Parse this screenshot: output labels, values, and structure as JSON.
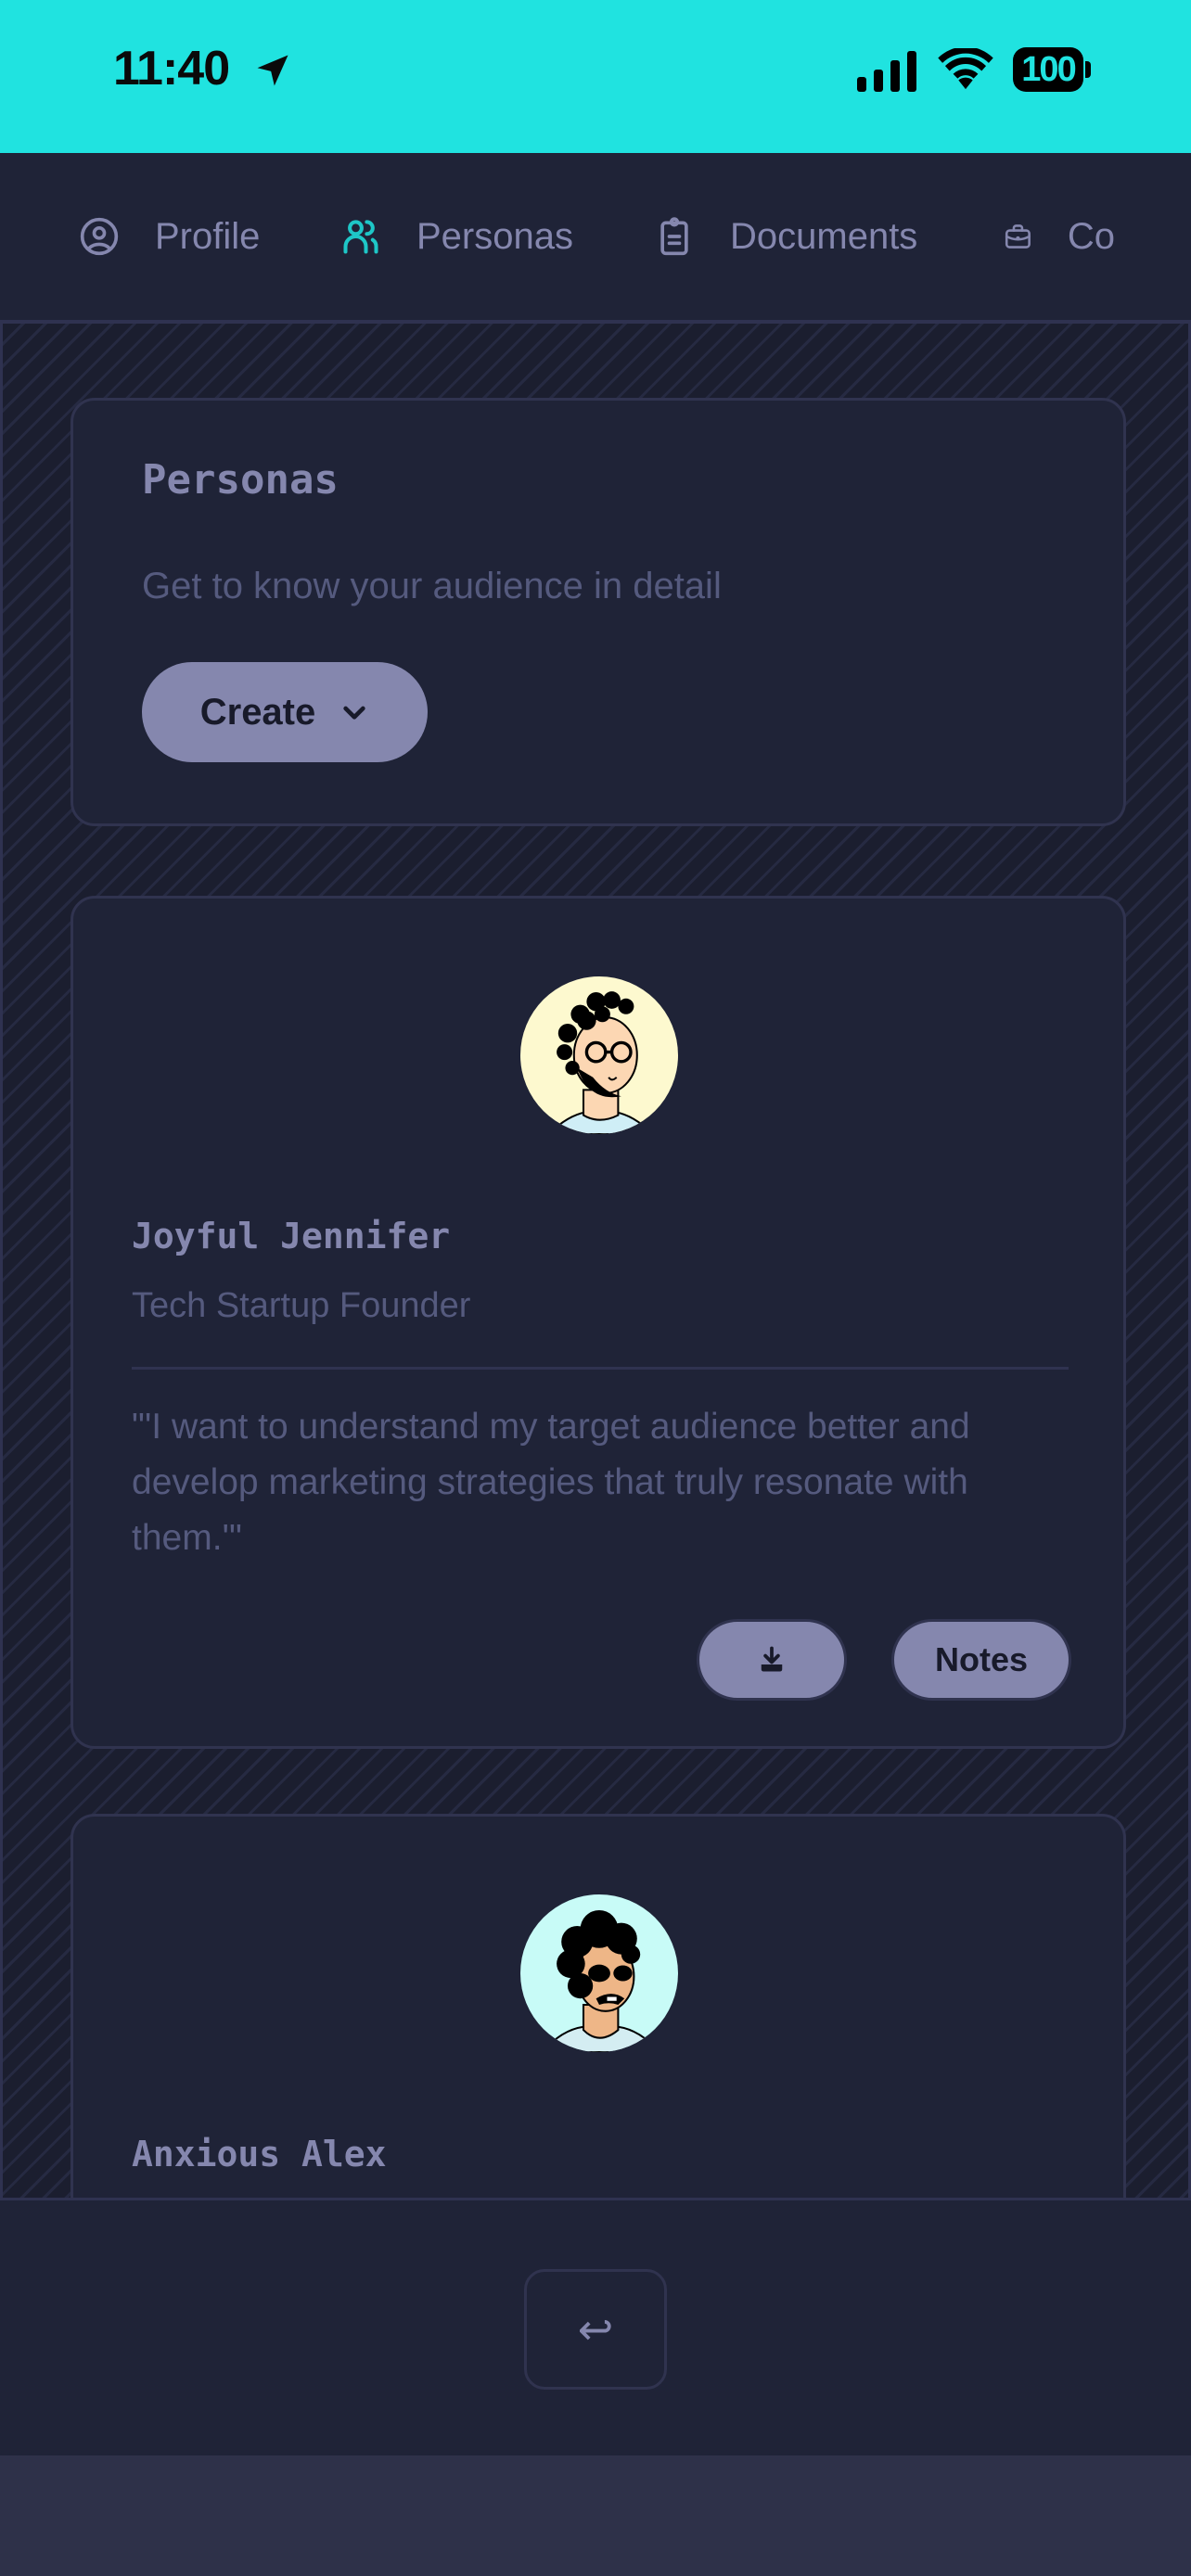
{
  "status_bar": {
    "time": "11:40",
    "battery": "100",
    "icons": [
      "location-arrow-icon",
      "cellular-signal-icon",
      "wifi-icon",
      "battery-icon"
    ]
  },
  "tabs": [
    {
      "label": "Profile",
      "icon": "user-circle-icon",
      "active": false
    },
    {
      "label": "Personas",
      "icon": "users-icon",
      "active": true
    },
    {
      "label": "Documents",
      "icon": "clipboard-icon",
      "active": false
    },
    {
      "label": "Co",
      "icon": "briefcase-icon",
      "active": false
    }
  ],
  "header": {
    "title": "Personas",
    "subtitle": "Get to know your audience in detail",
    "create_label": "Create"
  },
  "personas": [
    {
      "name": "Joyful Jennifer",
      "role": "Tech Startup Founder",
      "quote": "\"'I want to understand my target audience better and develop marketing strategies that truly resonate with them.'\"",
      "avatar_bg": "#fdf9cf",
      "notes_label": "Notes"
    },
    {
      "name": "Anxious Alex",
      "avatar_bg": "#c8fbf7"
    }
  ],
  "bottom": {
    "back_icon": "↩"
  },
  "colors": {
    "status_bar": "#20e3e0",
    "accent": "#1ec7c7",
    "button": "#8587ae",
    "card_bg": "#1f2337"
  }
}
